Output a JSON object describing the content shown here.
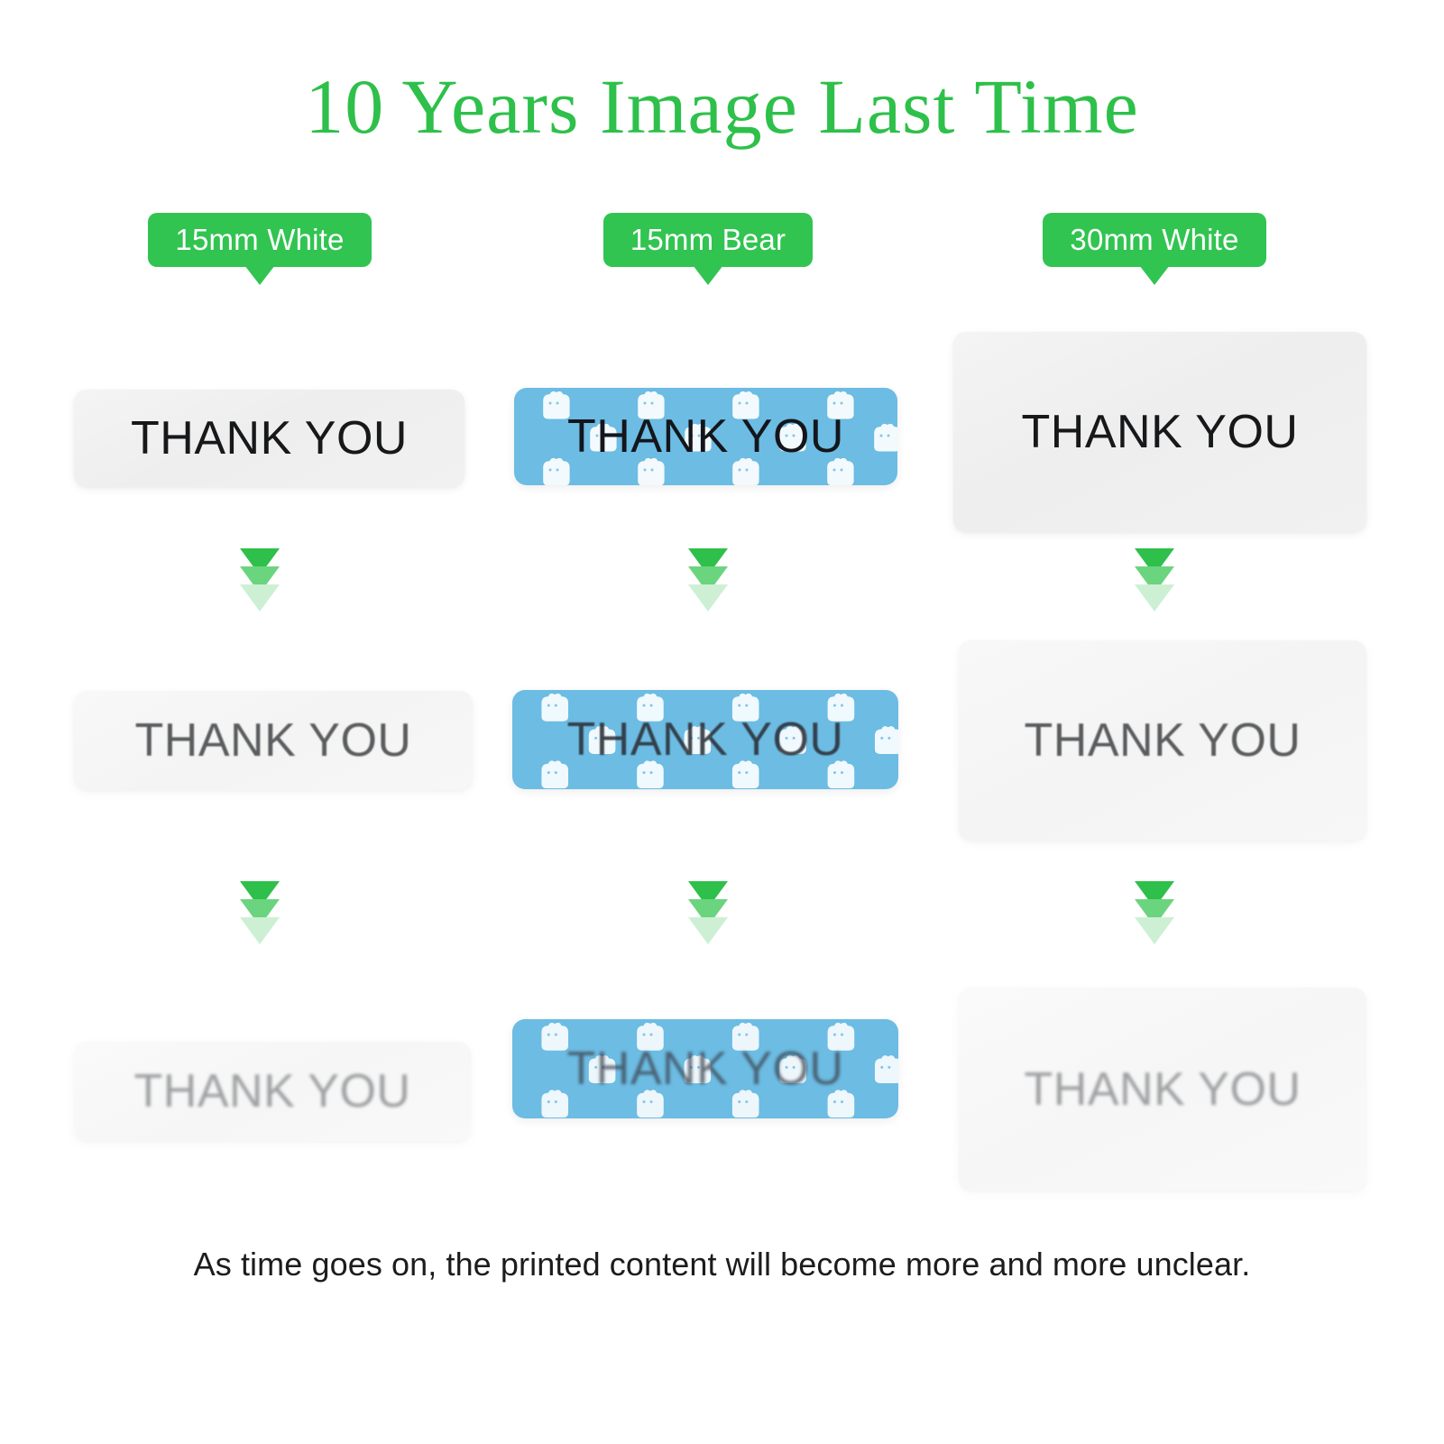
{
  "header": {
    "title": "10 Years Image Last Time",
    "title_color": "#2ec04a"
  },
  "caption": {
    "text": "As time goes on, the printed content will become more and more unclear."
  },
  "colors": {
    "brand_green": "#31c451",
    "title_green": "#2ec04a",
    "bear_blue": "#6cbce3",
    "arrow_strong": "#2ec04a",
    "arrow_mid": "#6bd47f",
    "arrow_faint": "#cdf0d4",
    "paper_gray": "#f1f1f1"
  },
  "columns": [
    {
      "badge_label": "15mm White",
      "material": "white",
      "rows": [
        {
          "label_text": "THANK YOU",
          "stage": "year-0",
          "clarity": "sharp"
        },
        {
          "label_text": "THANK YOU",
          "stage": "year-5",
          "clarity": "faded"
        },
        {
          "label_text": "THANK YOU",
          "stage": "year-10",
          "clarity": "very-faded"
        }
      ]
    },
    {
      "badge_label": "15mm Bear",
      "material": "bear",
      "rows": [
        {
          "label_text": "THANK YOU",
          "stage": "year-0",
          "clarity": "sharp"
        },
        {
          "label_text": "THANK YOU",
          "stage": "year-5",
          "clarity": "faded"
        },
        {
          "label_text": "THANK YOU",
          "stage": "year-10",
          "clarity": "very-faded"
        }
      ]
    },
    {
      "badge_label": "30mm White",
      "material": "white",
      "rows": [
        {
          "label_text": "THANK YOU",
          "stage": "year-0",
          "clarity": "sharp"
        },
        {
          "label_text": "THANK YOU",
          "stage": "year-5",
          "clarity": "faded"
        },
        {
          "label_text": "THANK YOU",
          "stage": "year-10",
          "clarity": "very-faded"
        }
      ]
    }
  ],
  "arrows": {
    "icon": "triple-chevron-down-icon",
    "count_per_stack": 3
  }
}
